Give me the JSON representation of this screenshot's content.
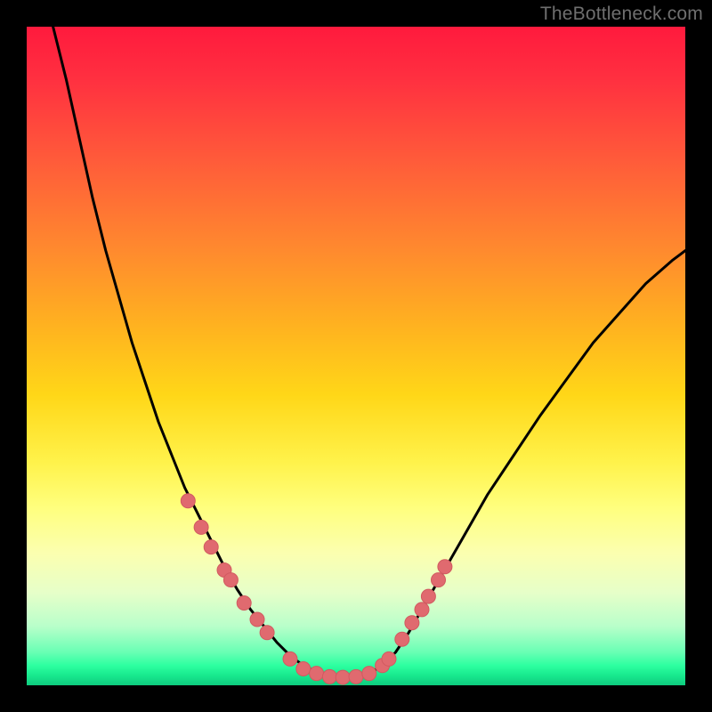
{
  "watermark": "TheBottleneck.com",
  "colors": {
    "curve": "#000000",
    "marker_fill": "#e06a6f",
    "marker_stroke": "#d15a60",
    "bg_black": "#000000"
  },
  "chart_data": {
    "type": "line",
    "title": "",
    "xlabel": "",
    "ylabel": "",
    "xlim": [
      0,
      100
    ],
    "ylim": [
      0,
      100
    ],
    "grid": false,
    "legend": false,
    "note": "Axes are unitless; values estimated from pixels. y=0 is bottom (green), y=100 is top (red). Curve is a V-shaped bottleneck metric with flat bottom ~x 41–52.",
    "series": [
      {
        "name": "curve",
        "x": [
          4,
          6,
          8,
          10,
          12,
          14,
          16,
          18,
          20,
          22,
          24,
          26,
          28,
          30,
          32,
          34,
          36,
          38,
          40,
          42,
          44,
          46,
          48,
          50,
          52,
          54,
          56,
          58,
          60,
          62,
          64,
          66,
          70,
          74,
          78,
          82,
          86,
          90,
          94,
          98,
          100
        ],
        "y": [
          100,
          92,
          83,
          74,
          66,
          59,
          52,
          46,
          40,
          35,
          30,
          26,
          22,
          18,
          14.5,
          11.5,
          9,
          6.5,
          4.5,
          3,
          2,
          1.5,
          1.2,
          1.3,
          1.8,
          3,
          5,
          8,
          11.5,
          15,
          18.5,
          22,
          29,
          35,
          41,
          46.5,
          52,
          56.5,
          61,
          64.5,
          66
        ]
      }
    ],
    "markers": {
      "name": "highlighted-points",
      "x": [
        24.5,
        26.5,
        28.0,
        30.0,
        31.0,
        33.0,
        35.0,
        36.5,
        40.0,
        42.0,
        44.0,
        46.0,
        48.0,
        50.0,
        52.0,
        54.0,
        55.0,
        57.0,
        58.5,
        60.0,
        61.0,
        62.5,
        63.5
      ],
      "y": [
        28.0,
        24.0,
        21.0,
        17.5,
        16.0,
        12.5,
        10.0,
        8.0,
        4.0,
        2.5,
        1.8,
        1.3,
        1.2,
        1.3,
        1.8,
        3.0,
        4.0,
        7.0,
        9.5,
        11.5,
        13.5,
        16.0,
        18.0
      ]
    }
  }
}
